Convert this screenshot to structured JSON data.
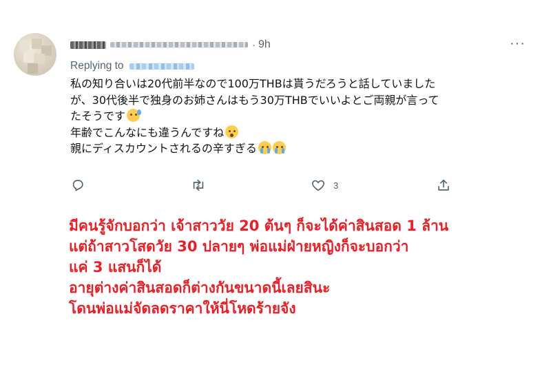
{
  "tweet": {
    "time": "9h",
    "replying_label": "Replying to",
    "lines": [
      "私の知り合いは20代前半なので100万THBは貰うだろうと話していまし",
      "が、30代後半で独身のお姉さんはもう30万THBでいいよとご両親が言っ",
      "たそうです",
      "年齢でこんなにも違うんですね",
      "親にディスカウントされるの辛すぎる"
    ],
    "line_ends": [
      "た",
      "て",
      "",
      "",
      ""
    ],
    "emojis": {
      "line3": "grinning-face-with-sweat",
      "line4": "hushed-face",
      "line5": [
        "sad-but-relieved-face",
        "sad-but-relieved-face"
      ]
    },
    "actions": {
      "reply_icon": "reply-icon",
      "retweet_icon": "retweet-icon",
      "like_icon": "heart-icon",
      "like_count": "3",
      "share_icon": "share-icon"
    },
    "more_label": "···"
  },
  "caption": {
    "lines": [
      "มีคนรู้จักบอกว่า เจ้าสาววัย 20 ต้นๆ ก็จะได้ค่าสินสอด 1 ล้าน",
      "แต่ถ้าสาวโสดวัย 30 ปลายๆ พ่อแม่ฝ่ายหญิงก็จะบอกว่า",
      "แค่ 3 แสนก็ได้",
      "อายุต่างค่าสินสอดก็ต่างกันขนาดนี้เลยสินะ",
      "โดนพ่อแม่จัดลดราคาให้นี่โหดร้ายจัง"
    ],
    "color": "#ee1d24"
  },
  "colors": {
    "text": "#0f1419",
    "muted": "#536471",
    "background": "#ffffff"
  }
}
